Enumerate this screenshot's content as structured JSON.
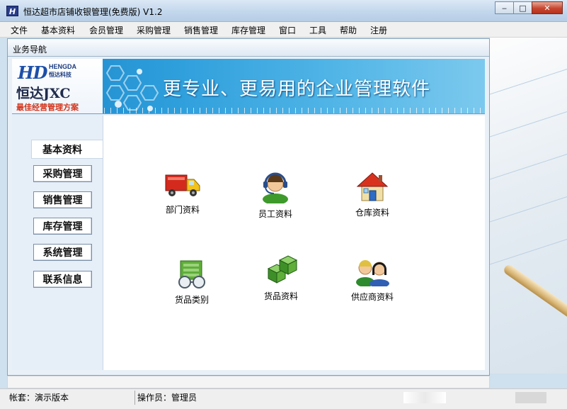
{
  "window": {
    "app_icon_text": "H",
    "title": "恒达超市店铺收银管理(免费版) V1.2",
    "minimize": "‒",
    "maximize": "□",
    "close": "✕"
  },
  "menu": [
    "文件",
    "基本资料",
    "会员管理",
    "采购管理",
    "销售管理",
    "库存管理",
    "窗口",
    "工具",
    "帮助",
    "注册"
  ],
  "panel": {
    "title": "业务导航"
  },
  "banner": {
    "logo_mark": "HD",
    "logo_en": "HENGDA",
    "logo_cn": "恒达科技",
    "product": "恒达JXC",
    "tagline": "最佳经营管理方案",
    "slogan": "更专业、更易用的企业管理软件"
  },
  "nav": [
    "基本资料",
    "采购管理",
    "销售管理",
    "库存管理",
    "系统管理",
    "联系信息"
  ],
  "nav_active_index": 0,
  "tiles": [
    {
      "label": "部门资料",
      "icon": "truck-icon"
    },
    {
      "label": "员工资料",
      "icon": "headset-operator-icon"
    },
    {
      "label": "仓库资料",
      "icon": "house-icon"
    },
    {
      "label": "货品类别",
      "icon": "category-box-icon"
    },
    {
      "label": "货品资料",
      "icon": "cubes-icon"
    },
    {
      "label": "供应商资料",
      "icon": "people-icon"
    }
  ],
  "status": {
    "account": "帐套：演示版本",
    "operator": "操作员：管理员"
  },
  "colors": {
    "banner_blue": "#1b86c9",
    "tagline_red": "#d2331b",
    "close_red": "#c8462f"
  }
}
